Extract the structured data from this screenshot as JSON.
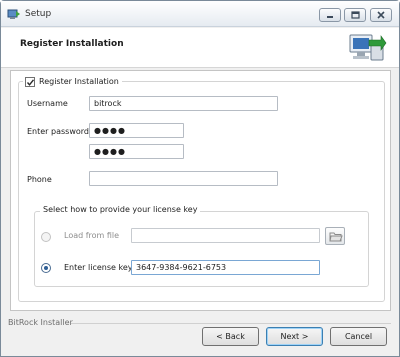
{
  "window": {
    "title": "Setup",
    "minimize_icon": "minimize-icon",
    "maximize_icon": "maximize-icon",
    "close_icon": "close-icon"
  },
  "header": {
    "title": "Register Installation",
    "logo_icon": "installer-computer-icon"
  },
  "form": {
    "register_checkbox": {
      "label": "Register Installation",
      "checked": true
    },
    "username": {
      "label": "Username",
      "value": "bitrock"
    },
    "password": {
      "label": "Enter password",
      "value": "●●●●",
      "confirm_value": "●●●●"
    },
    "phone": {
      "label": "Phone",
      "value": ""
    },
    "license_group": {
      "legend": "Select how to provide your license key",
      "load_from_file": {
        "label": "Load from file",
        "value": "",
        "selected": false,
        "enabled": false
      },
      "enter_key": {
        "label": "Enter license key",
        "value": "3647-9384-9621-6753",
        "selected": true
      }
    }
  },
  "footer": {
    "brand": "BitRock Installer",
    "back_label": "< Back",
    "next_label": "Next >",
    "cancel_label": "Cancel"
  },
  "colors": {
    "accent": "#2f5f96",
    "window_bg": "#f0f0f0",
    "default_button_border": "#3c7fb1"
  }
}
